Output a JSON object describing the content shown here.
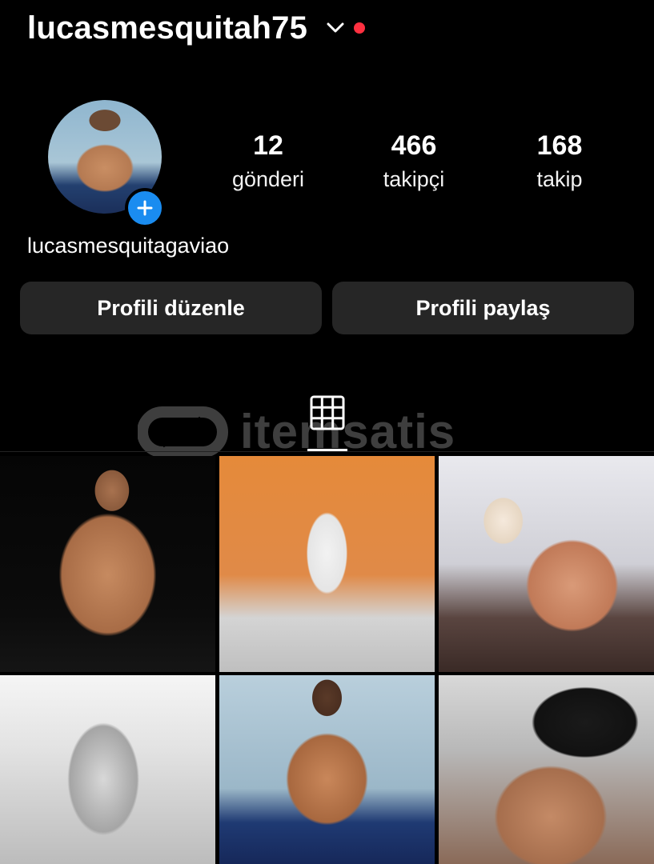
{
  "header": {
    "username": "lucasmesquitah75",
    "switch_icon": "chevron-down-icon",
    "notification_color": "#ff3040"
  },
  "profile": {
    "display_name": "lucasmesquitagaviao",
    "add_story_icon": "plus-icon",
    "badge_color": "#1a8cf0"
  },
  "stats": {
    "posts": {
      "value": "12",
      "label": "gönderi"
    },
    "followers": {
      "value": "466",
      "label": "takipçi"
    },
    "following": {
      "value": "168",
      "label": "takip"
    }
  },
  "buttons": {
    "edit": "Profili düzenle",
    "share": "Profili paylaş"
  },
  "tabs": {
    "active": "grid-icon"
  },
  "watermark": {
    "text": "itemsatis"
  },
  "posts": [
    {
      "id": 1,
      "desc": "post-1"
    },
    {
      "id": 2,
      "desc": "post-2"
    },
    {
      "id": 3,
      "desc": "post-3"
    },
    {
      "id": 4,
      "desc": "post-4"
    },
    {
      "id": 5,
      "desc": "post-5"
    },
    {
      "id": 6,
      "desc": "post-6"
    }
  ]
}
